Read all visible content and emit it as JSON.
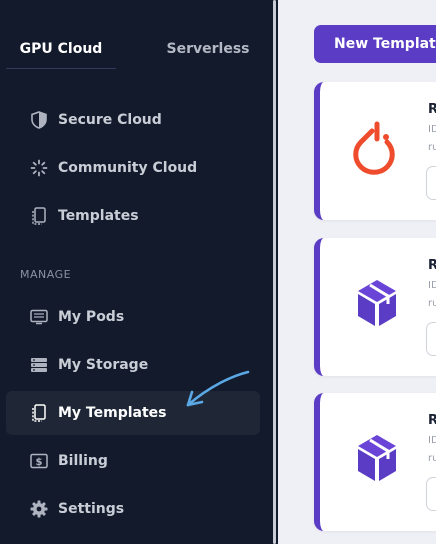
{
  "sidebar": {
    "tabs": [
      {
        "label": "GPU Cloud",
        "active": true
      },
      {
        "label": "Serverless",
        "active": false
      }
    ],
    "cloud_items": [
      {
        "label": "Secure Cloud",
        "icon": "shield-icon"
      },
      {
        "label": "Community Cloud",
        "icon": "dotted-burst-icon"
      },
      {
        "label": "Templates",
        "icon": "template-icon"
      }
    ],
    "manage_section_label": "MANAGE",
    "manage_items": [
      {
        "label": "My Pods",
        "icon": "server-icon"
      },
      {
        "label": "My Storage",
        "icon": "storage-icon"
      },
      {
        "label": "My Templates",
        "icon": "template-icon",
        "active": true
      },
      {
        "label": "Billing",
        "icon": "dollar-icon"
      },
      {
        "label": "Settings",
        "icon": "gear-icon"
      }
    ]
  },
  "main": {
    "new_template_label": "New Template",
    "cards": [
      {
        "title": "R",
        "line1": "ID",
        "line2": "ru",
        "logo": "pytorch-logo"
      },
      {
        "title": "R",
        "line1": "ID",
        "line2": "ru",
        "logo": "cube-logo"
      },
      {
        "title": "R",
        "line1": "ID",
        "line2": "ru",
        "logo": "cube-logo"
      }
    ]
  },
  "colors": {
    "sidebar_bg": "#121a2c",
    "accent": "#5b3cc4",
    "pytorch": "#ee4c2c",
    "annotation": "#5aa9e6"
  }
}
